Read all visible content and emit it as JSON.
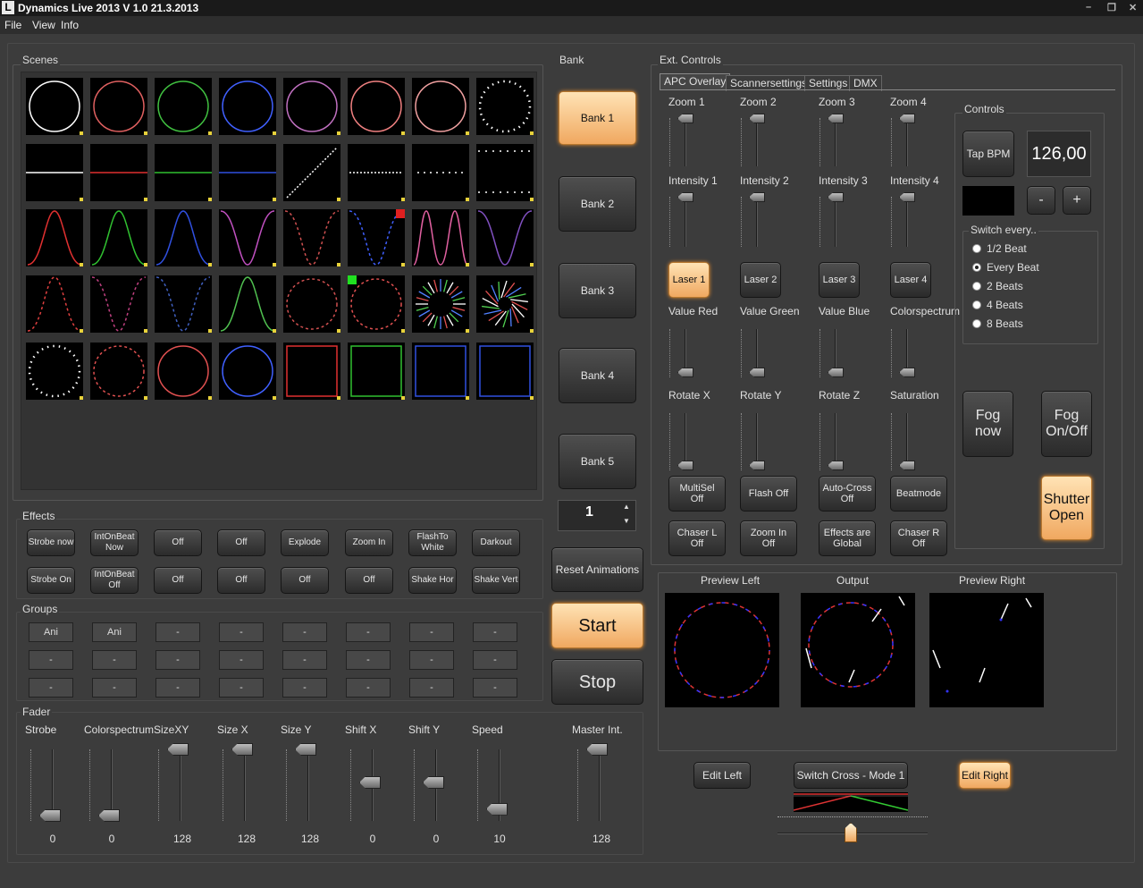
{
  "window": {
    "title": "Dynamics Live 2013   V 1.0  21.3.2013",
    "logo": "L",
    "controls": [
      "–",
      "❐",
      "✕"
    ]
  },
  "menu": [
    "File",
    "View",
    "Info"
  ],
  "sections": {
    "scenes": "Scenes",
    "bank": "Bank",
    "ext_controls": "Ext. Controls",
    "effects": "Effects",
    "groups": "Groups",
    "fader": "Fader",
    "controls": "Controls",
    "switch_every": "Switch every.."
  },
  "banks": [
    "Bank 1",
    "Bank 2",
    "Bank 3",
    "Bank 4",
    "Bank 5"
  ],
  "bank_spinner": "1",
  "reset_animations": "Reset Animations",
  "start": "Start",
  "stop": "Stop",
  "effects_row1": [
    "Strobe now",
    "IntOnBeat Now",
    "Off",
    "Off",
    "Explode",
    "Zoom In",
    "FlashTo White",
    "Darkout"
  ],
  "effects_row2": [
    "Strobe On",
    "IntOnBeat Off",
    "Off",
    "Off",
    "Off",
    "Off",
    "Shake Hor",
    "Shake Vert"
  ],
  "groups_row1": [
    "Ani",
    "Ani",
    "-",
    "-",
    "-",
    "-",
    "-",
    "-"
  ],
  "groups_row2": [
    "-",
    "-",
    "-",
    "-",
    "-",
    "-",
    "-",
    "-"
  ],
  "groups_row3": [
    "-",
    "-",
    "-",
    "-",
    "-",
    "-",
    "-",
    "-"
  ],
  "faders": [
    {
      "label": "Strobe",
      "value": "0",
      "level": 0
    },
    {
      "label": "Colorspectrum",
      "value": "0",
      "level": 0
    },
    {
      "label": "SizeXY",
      "value": "128",
      "level": 1
    },
    {
      "label": "Size X",
      "value": "128",
      "level": 1
    },
    {
      "label": "Size Y",
      "value": "128",
      "level": 1
    },
    {
      "label": "Shift X",
      "value": "0",
      "level": 0.5
    },
    {
      "label": "Shift Y",
      "value": "0",
      "level": 0.5
    },
    {
      "label": "Speed",
      "value": "10",
      "level": 0.1
    },
    {
      "label": "Master Int.",
      "value": "128",
      "level": 1
    }
  ],
  "tabs": [
    "APC Overlay",
    "Scannersettings",
    "Settings",
    "DMX"
  ],
  "zoom_labels": [
    "Zoom 1",
    "Zoom 2",
    "Zoom 3",
    "Zoom 4"
  ],
  "intensity_labels": [
    "Intensity 1",
    "Intensity 2",
    "Intensity 3",
    "Intensity 4"
  ],
  "laser_buttons": [
    "Laser 1",
    "Laser 2",
    "Laser 3",
    "Laser 4"
  ],
  "value_labels": [
    "Value Red",
    "Value Green",
    "Value Blue",
    "Colorspectrum"
  ],
  "rotate_labels": [
    "Rotate X",
    "Rotate Y",
    "Rotate Z",
    "Saturation"
  ],
  "mode_row1": [
    "MultiSel Off",
    "Flash Off",
    "Auto-Cross Off",
    "Beatmode"
  ],
  "mode_row2": [
    "Chaser L Off",
    "Zoom In Off",
    "Effects are Global",
    "Chaser R Off"
  ],
  "tap_bpm": "Tap BPM",
  "bpm_value": "126,00",
  "minus": "-",
  "plus": "+",
  "switch_options": [
    "1/2 Beat",
    "Every Beat",
    "2 Beats",
    "4 Beats",
    "8 Beats"
  ],
  "switch_selected": 1,
  "fog_now": "Fog now",
  "fog_onoff": "Fog On/Off",
  "shutter": "Shutter Open",
  "preview_labels": [
    "Preview Left",
    "Output",
    "Preview Right"
  ],
  "edit_left": "Edit Left",
  "switch_cross": "Switch Cross - Mode 1",
  "edit_right": "Edit Right",
  "colors": {
    "orange": "#f0a860",
    "bg": "#3c3c3c",
    "yellow_badge": "#e8d23a"
  }
}
